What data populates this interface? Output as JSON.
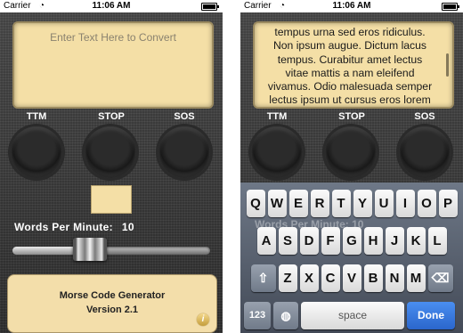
{
  "status": {
    "carrier": "Carrier",
    "time": "11:06 AM"
  },
  "left": {
    "input": {
      "placeholder": "Enter Text Here to Convert"
    },
    "buttons": {
      "ttm": "TTM",
      "stop": "STOP",
      "sos": "SOS"
    },
    "wpm": {
      "label": "Words Per Minute:",
      "value": "10"
    },
    "slider": {
      "value": 10
    },
    "info": {
      "title": "Morse Code Generator",
      "version": "Version 2.1",
      "icon": "i"
    }
  },
  "right": {
    "paragraph_lines": [
      "tempus urna sed eros ridiculus.",
      "Non ipsum augue. Dictum lacus",
      "tempus. Curabitur amet lectus",
      "vitae mattis a nam eleifend",
      "vivamus. Odio malesuada semper",
      "lectus ipsum ut cursus eros lorem"
    ],
    "buttons": {
      "ttm": "TTM",
      "stop": "STOP",
      "sos": "SOS"
    },
    "behind_text": "Words Per Minute: 10",
    "keyboard": {
      "row1": [
        "Q",
        "W",
        "E",
        "R",
        "T",
        "Y",
        "U",
        "I",
        "O",
        "P"
      ],
      "row2": [
        "A",
        "S",
        "D",
        "F",
        "G",
        "H",
        "J",
        "K",
        "L"
      ],
      "row3": [
        "Z",
        "X",
        "C",
        "V",
        "B",
        "N",
        "M"
      ],
      "numbers": "123",
      "space": "space",
      "done": "Done"
    }
  }
}
